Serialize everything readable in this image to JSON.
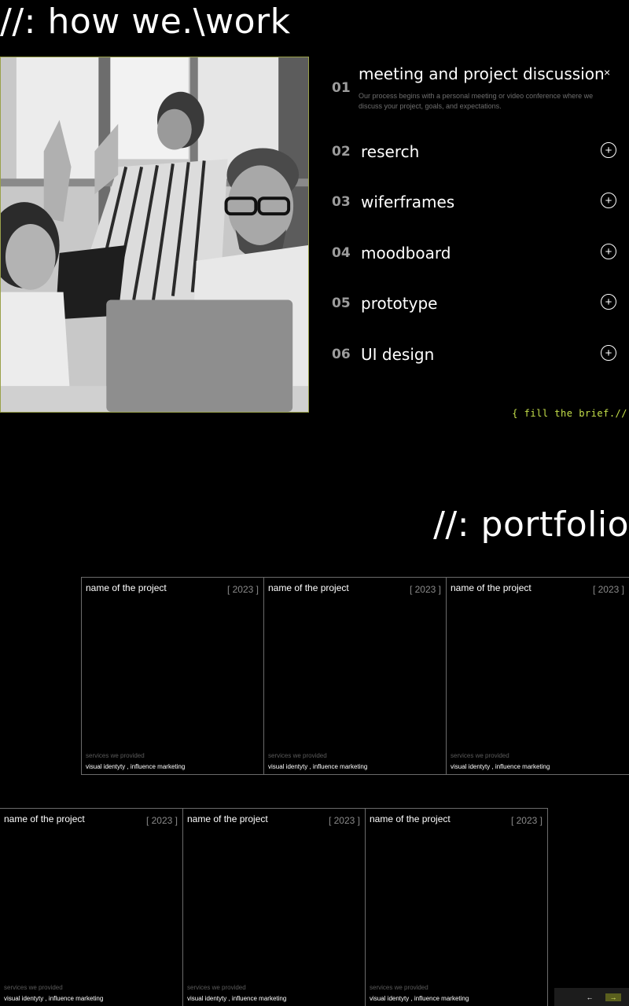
{
  "how_we_work": {
    "title": "//: how we.\\work",
    "steps": [
      {
        "num": "01",
        "label": "meeting and project discussion",
        "expanded": true,
        "description": "Our process begins with a personal meeting or video conference where we discuss your project, goals, and expectations.",
        "close_icon": "×"
      },
      {
        "num": "02",
        "label": "reserch",
        "expanded": false,
        "toggle_icon": "+"
      },
      {
        "num": "03",
        "label": "wiferframes",
        "expanded": false,
        "toggle_icon": "+"
      },
      {
        "num": "04",
        "label": "moodboard",
        "expanded": false,
        "toggle_icon": "+"
      },
      {
        "num": "05",
        "label": "prototype",
        "expanded": false,
        "toggle_icon": "+"
      },
      {
        "num": "06",
        "label": "UI design",
        "expanded": false,
        "toggle_icon": "+"
      }
    ],
    "brief_link": "{ fill the brief.//",
    "accent_color": "#c5e04a"
  },
  "portfolio": {
    "title": "//: portfolio",
    "row1": [
      {
        "name": "name of the project",
        "year": "[ 2023 ]",
        "services_label": "services we provided",
        "services": "visual identyty , influence marketing"
      },
      {
        "name": "name of the project",
        "year": "[ 2023 ]",
        "services_label": "services we provided",
        "services": "visual identyty , influence marketing"
      },
      {
        "name": "name of the project",
        "year": "[ 2023 ]",
        "services_label": "services we provided",
        "services": "visual identyty , influence marketing"
      }
    ],
    "row2": [
      {
        "name": "name of the project",
        "year": "[ 2023 ]",
        "services_label": "services we provided",
        "services": "visual identyty , influence marketing"
      },
      {
        "name": "name of the project",
        "year": "[ 2023 ]",
        "services_label": "services we provided",
        "services": "visual identyty , influence marketing"
      },
      {
        "name": "name of the project",
        "year": "[ 2023 ]",
        "services_label": "services we provided",
        "services": "visual identyty , influence marketing"
      }
    ],
    "pager": {
      "prev": "←",
      "next": "→"
    }
  }
}
